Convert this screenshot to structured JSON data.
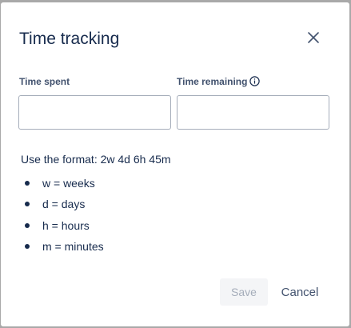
{
  "dialog": {
    "title": "Time tracking",
    "close_icon": "close-icon"
  },
  "fields": {
    "time_spent": {
      "label": "Time spent",
      "value": "",
      "placeholder": ""
    },
    "time_remaining": {
      "label": "Time remaining",
      "value": "",
      "placeholder": "",
      "info_icon": "info-icon"
    }
  },
  "help": {
    "format": "Use the format: 2w 4d 6h 45m",
    "units": [
      "w = weeks",
      "d = days",
      "h = hours",
      "m = minutes"
    ]
  },
  "actions": {
    "save_label": "Save",
    "cancel_label": "Cancel"
  }
}
